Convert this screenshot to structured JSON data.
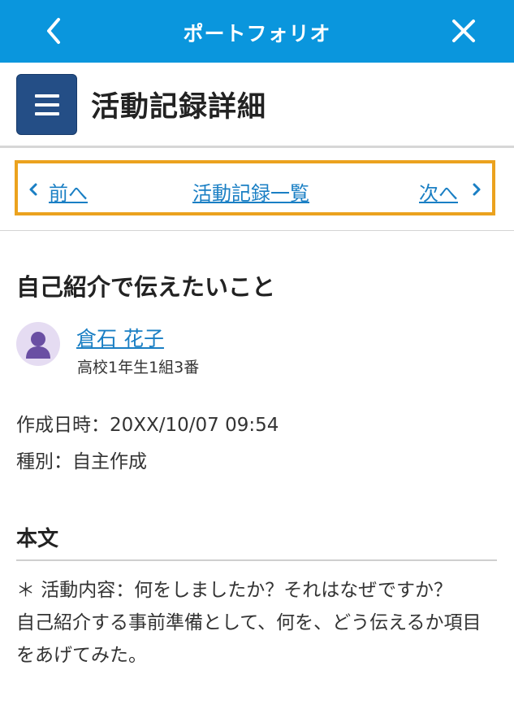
{
  "topbar": {
    "title": "ポートフォリオ"
  },
  "header": {
    "title": "活動記録詳細"
  },
  "nav": {
    "prev": "前へ",
    "list": "活動記録一覧",
    "next": "次へ"
  },
  "entry": {
    "title": "自己紹介で伝えたいこと",
    "author": {
      "name": "倉石 花子",
      "class": "高校1年生1組3番"
    },
    "created": "作成日時：20XX/10/07 09:54",
    "type": "種別：自主作成"
  },
  "body": {
    "heading": "本文",
    "paragraphs": [
      "＊ 活動内容：何をしましたか？それはなぜですか？",
      "自己紹介する事前準備として、何を、どう伝えるか項目をあげてみた。"
    ]
  },
  "colors": {
    "topbar": "#0a96dd",
    "menu_button": "#244e86",
    "link": "#1a7fc4",
    "highlight_border": "#eba21e",
    "avatar_bg": "#e5dcf2",
    "avatar_fg": "#6a4fa3"
  },
  "icons": {
    "back": "chevron-left-icon",
    "close": "close-icon",
    "menu": "hamburger-icon",
    "avatar": "person-icon"
  }
}
